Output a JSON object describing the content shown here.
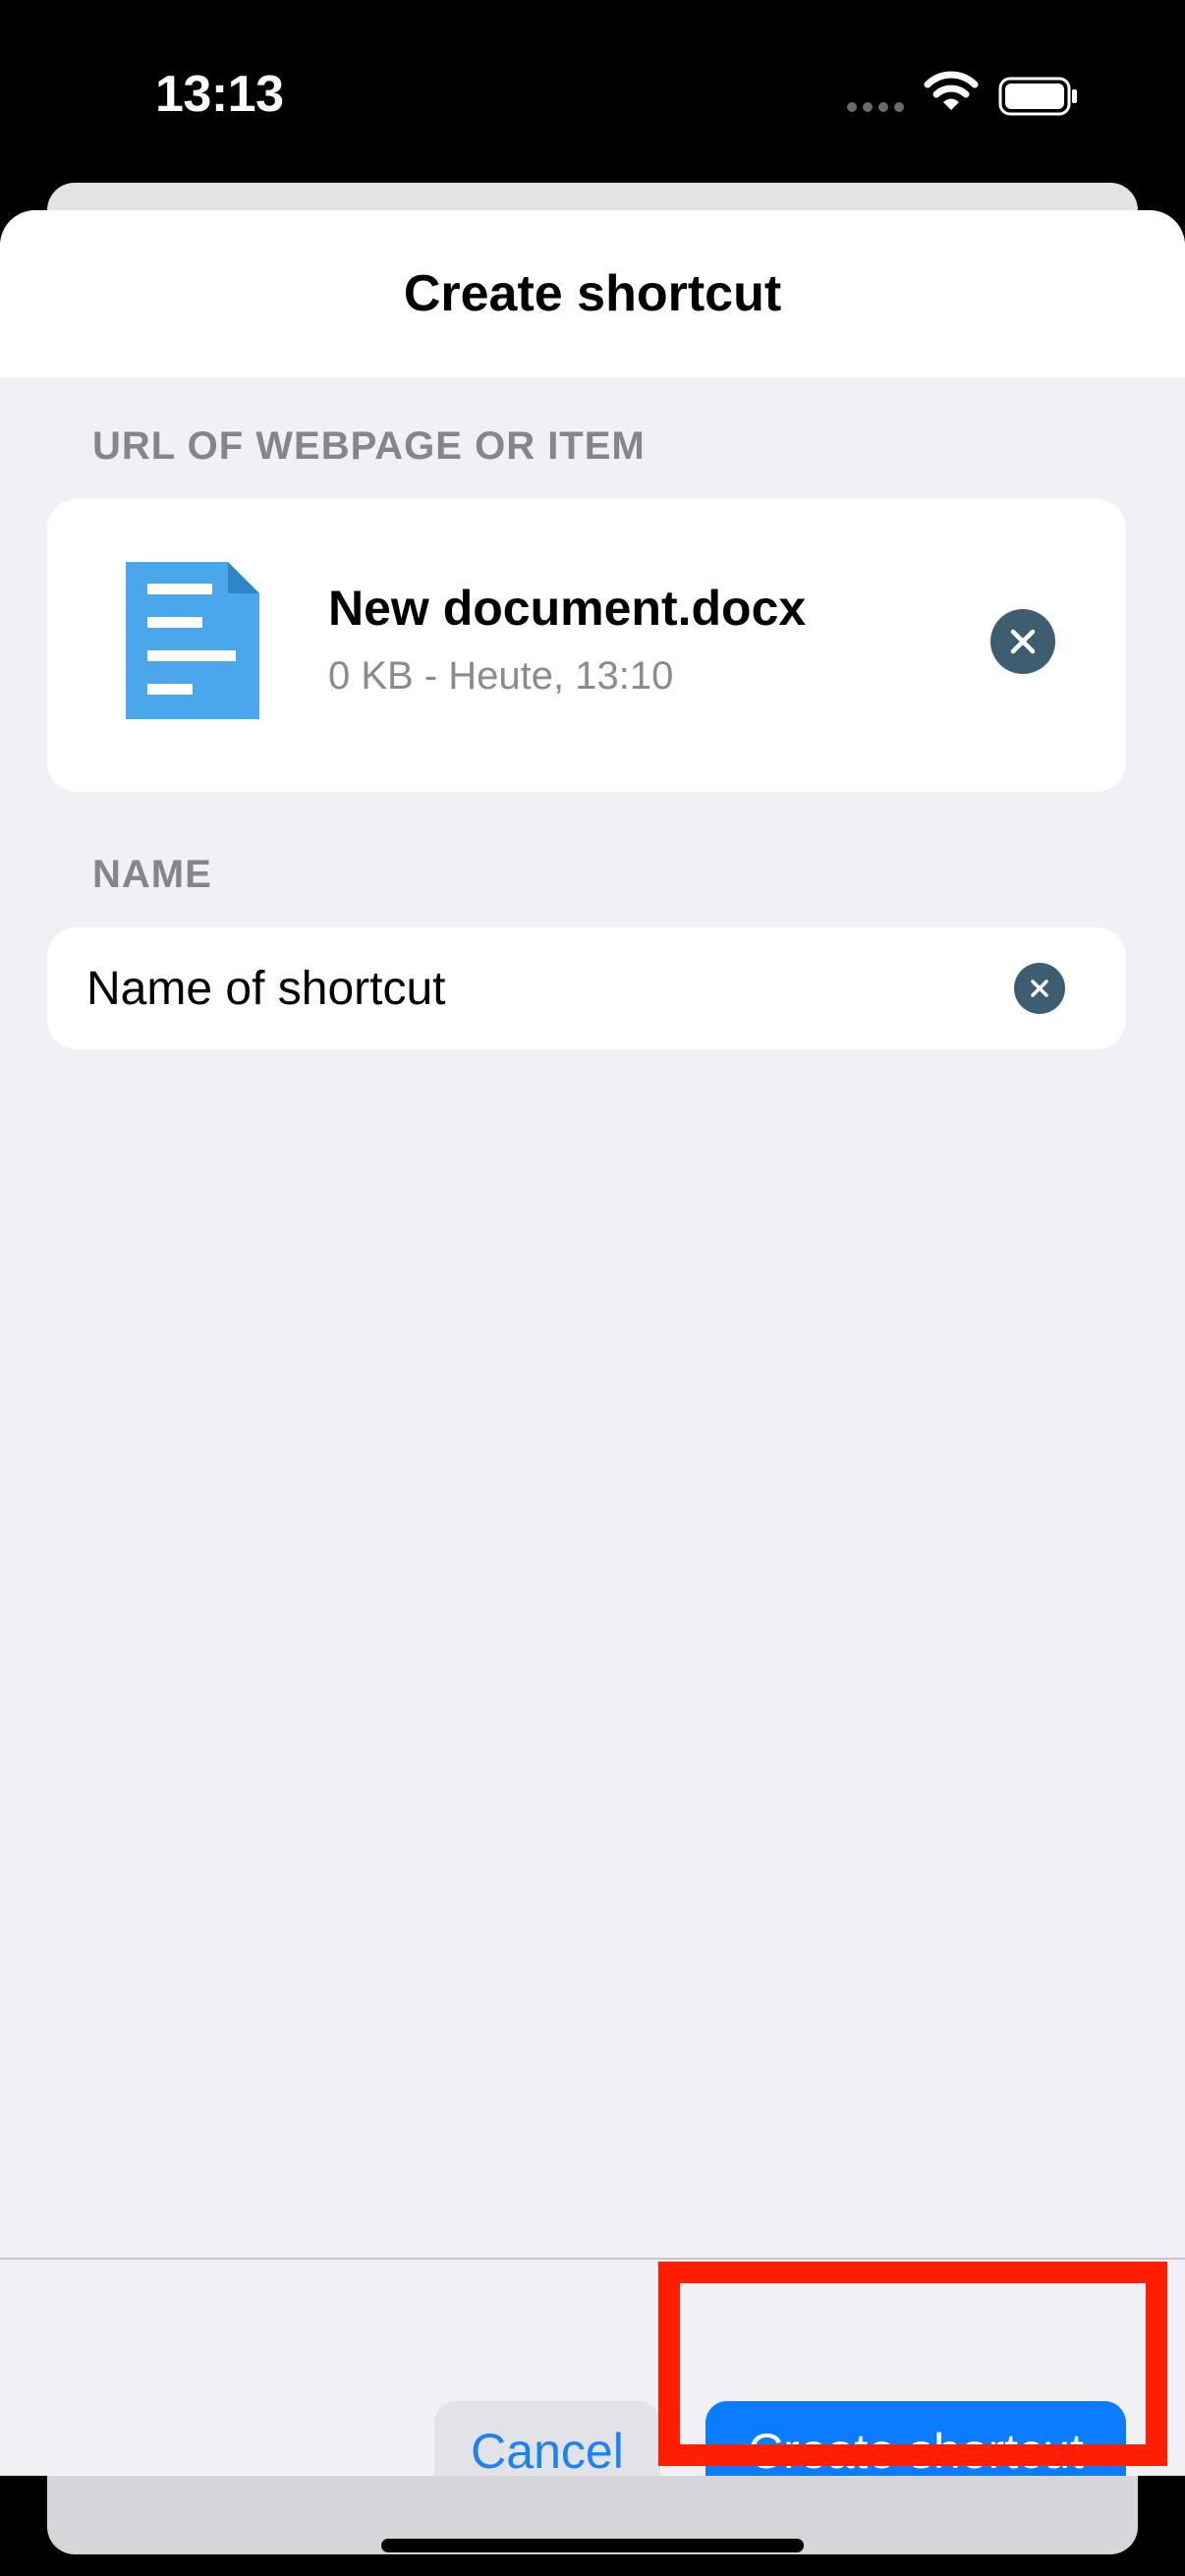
{
  "status_bar": {
    "time": "13:13"
  },
  "sheet": {
    "title": "Create shortcut",
    "url_section_label": "URL OF WEBPAGE OR ITEM",
    "file": {
      "name": "New document.docx",
      "meta": "0 KB - Heute, 13:10"
    },
    "name_section_label": "NAME",
    "name_input": {
      "placeholder": "Name of shortcut",
      "value": ""
    }
  },
  "footer": {
    "cancel_label": "Cancel",
    "create_label": "Create shortcut"
  },
  "colors": {
    "accent": "#0a7cff",
    "clear_button": "#3d5d70",
    "doc_icon": "#4aa8ea",
    "highlight": "#ff1e00"
  }
}
